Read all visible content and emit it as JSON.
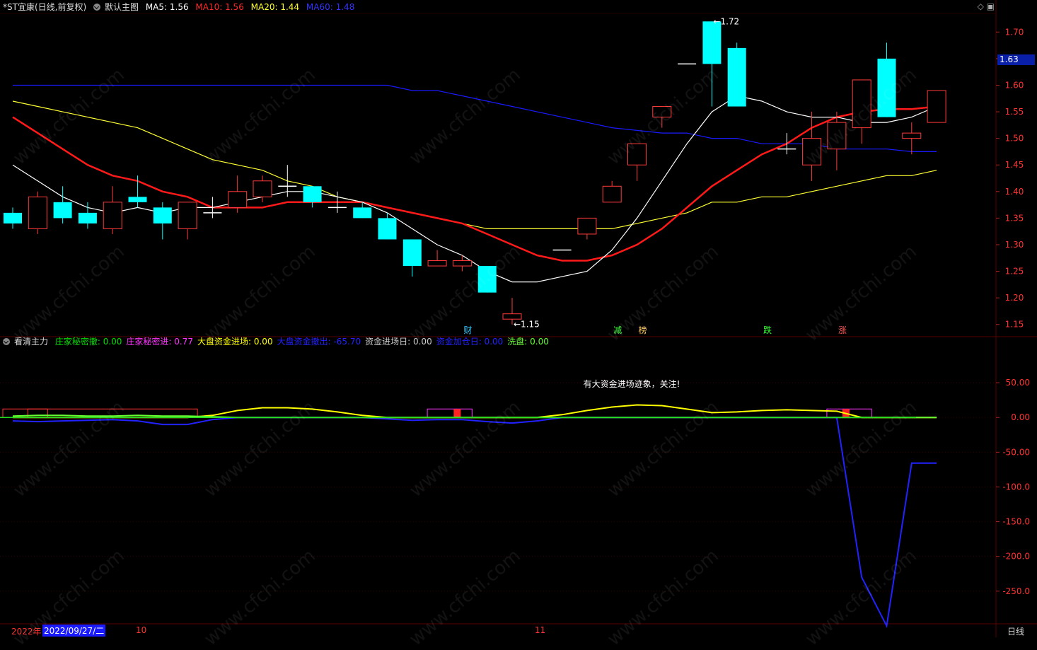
{
  "header": {
    "stock": "*ST宜康",
    "period": "(日线,前复权)",
    "main_chart_label": "默认主图",
    "ma5": "MA5: 1.56",
    "ma10": "MA10: 1.56",
    "ma20": "MA20: 1.44",
    "ma60": "MA60: 1.48"
  },
  "indicator_header": {
    "name": "看清主力",
    "items": [
      {
        "label": "庄家秘密撤: 0.00",
        "color": "#00e000"
      },
      {
        "label": "庄家秘密进: 0.77",
        "color": "#ff33ff"
      },
      {
        "label": "大盘资金进场: 0.00",
        "color": "#ffff00"
      },
      {
        "label": "大盘资金撤出: -65.70",
        "color": "#2222ff"
      },
      {
        "label": "资金进场日: 0.00",
        "color": "#cccccc"
      },
      {
        "label": "资金加仓日: 0.00",
        "color": "#2222ff"
      },
      {
        "label": "洗盘: 0.00",
        "color": "#66ff33"
      }
    ]
  },
  "top_icons": "◇ ▣",
  "current_price": "1.63",
  "footer": {
    "year": "2022年",
    "date": "2022/09/27/二",
    "month_oct": "10",
    "month_nov": "11",
    "period_label": "日线"
  },
  "watermark": "www.cfchi.com",
  "colors": {
    "up": "#ff3b3b",
    "down": "#00ffff",
    "ma5": "#ffffff",
    "ma10": "#ff1a1a",
    "ma20": "#ffff33",
    "ma60": "#1a1aff",
    "grid": "#5a0000"
  },
  "chart_data": [
    {
      "type": "candlestick",
      "price_axis": {
        "ticks": [
          "1.70",
          "1.65",
          "1.60",
          "1.55",
          "1.50",
          "1.45",
          "1.40",
          "1.35",
          "1.30",
          "1.25",
          "1.20",
          "1.15"
        ],
        "ylim": [
          1.135,
          1.735
        ]
      },
      "candles": [
        {
          "o": 1.36,
          "h": 1.37,
          "l": 1.33,
          "c": 1.34
        },
        {
          "o": 1.33,
          "h": 1.4,
          "l": 1.32,
          "c": 1.39
        },
        {
          "o": 1.38,
          "h": 1.41,
          "l": 1.34,
          "c": 1.35
        },
        {
          "o": 1.36,
          "h": 1.38,
          "l": 1.33,
          "c": 1.34
        },
        {
          "o": 1.33,
          "h": 1.41,
          "l": 1.32,
          "c": 1.38
        },
        {
          "o": 1.39,
          "h": 1.43,
          "l": 1.37,
          "c": 1.38
        },
        {
          "o": 1.37,
          "h": 1.38,
          "l": 1.31,
          "c": 1.34
        },
        {
          "o": 1.33,
          "h": 1.38,
          "l": 1.31,
          "c": 1.38
        },
        {
          "o": 1.36,
          "h": 1.39,
          "l": 1.35,
          "c": 1.36
        },
        {
          "o": 1.37,
          "h": 1.43,
          "l": 1.36,
          "c": 1.4
        },
        {
          "o": 1.39,
          "h": 1.43,
          "l": 1.38,
          "c": 1.42
        },
        {
          "o": 1.41,
          "h": 1.45,
          "l": 1.39,
          "c": 1.41
        },
        {
          "o": 1.41,
          "h": 1.41,
          "l": 1.37,
          "c": 1.38
        },
        {
          "o": 1.37,
          "h": 1.4,
          "l": 1.36,
          "c": 1.37
        },
        {
          "o": 1.37,
          "h": 1.38,
          "l": 1.35,
          "c": 1.35
        },
        {
          "o": 1.35,
          "h": 1.36,
          "l": 1.31,
          "c": 1.31
        },
        {
          "o": 1.31,
          "h": 1.31,
          "l": 1.24,
          "c": 1.26
        },
        {
          "o": 1.26,
          "h": 1.29,
          "l": 1.26,
          "c": 1.27
        },
        {
          "o": 1.26,
          "h": 1.28,
          "l": 1.25,
          "c": 1.27
        },
        {
          "o": 1.26,
          "h": 1.26,
          "l": 1.21,
          "c": 1.21
        },
        {
          "o": 1.16,
          "h": 1.2,
          "l": 1.15,
          "c": 1.17
        },
        null,
        {
          "o": 1.29,
          "h": 1.29,
          "l": 1.29,
          "c": 1.29
        },
        {
          "o": 1.32,
          "h": 1.35,
          "l": 1.31,
          "c": 1.35
        },
        {
          "o": 1.38,
          "h": 1.42,
          "l": 1.38,
          "c": 1.41
        },
        {
          "o": 1.45,
          "h": 1.49,
          "l": 1.42,
          "c": 1.49
        },
        {
          "o": 1.54,
          "h": 1.56,
          "l": 1.52,
          "c": 1.56
        },
        {
          "o": 1.64,
          "h": 1.64,
          "l": 1.64,
          "c": 1.64
        },
        {
          "o": 1.72,
          "h": 1.72,
          "l": 1.56,
          "c": 1.64
        },
        {
          "o": 1.67,
          "h": 1.68,
          "l": 1.56,
          "c": 1.56
        },
        null,
        {
          "o": 1.48,
          "h": 1.51,
          "l": 1.47,
          "c": 1.48
        },
        {
          "o": 1.45,
          "h": 1.55,
          "l": 1.42,
          "c": 1.5
        },
        {
          "o": 1.48,
          "h": 1.55,
          "l": 1.44,
          "c": 1.53
        },
        {
          "o": 1.52,
          "h": 1.61,
          "l": 1.49,
          "c": 1.61
        },
        {
          "o": 1.65,
          "h": 1.68,
          "l": 1.54,
          "c": 1.54
        },
        {
          "o": 1.5,
          "h": 1.53,
          "l": 1.47,
          "c": 1.51
        },
        {
          "o": 1.53,
          "h": 1.59,
          "l": 1.53,
          "c": 1.59
        }
      ],
      "ma5": [
        1.45,
        1.42,
        1.39,
        1.37,
        1.36,
        1.37,
        1.36,
        1.37,
        1.37,
        1.38,
        1.39,
        1.4,
        1.4,
        1.39,
        1.38,
        1.36,
        1.33,
        1.3,
        1.28,
        1.25,
        1.23,
        1.23,
        1.24,
        1.25,
        1.29,
        1.35,
        1.42,
        1.49,
        1.55,
        1.58,
        1.57,
        1.55,
        1.54,
        1.54,
        1.53,
        1.53,
        1.54,
        1.56
      ],
      "ma10": [
        1.54,
        1.51,
        1.48,
        1.45,
        1.43,
        1.42,
        1.4,
        1.39,
        1.37,
        1.37,
        1.37,
        1.38,
        1.38,
        1.38,
        1.38,
        1.37,
        1.36,
        1.35,
        1.34,
        1.32,
        1.3,
        1.28,
        1.27,
        1.27,
        1.28,
        1.3,
        1.33,
        1.37,
        1.41,
        1.44,
        1.47,
        1.49,
        1.52,
        1.54,
        1.55,
        1.555,
        1.555,
        1.56
      ],
      "ma20": [
        1.57,
        1.56,
        1.55,
        1.54,
        1.53,
        1.52,
        1.5,
        1.48,
        1.46,
        1.45,
        1.44,
        1.42,
        1.41,
        1.39,
        1.38,
        1.37,
        1.36,
        1.35,
        1.34,
        1.33,
        1.33,
        1.33,
        1.33,
        1.33,
        1.33,
        1.34,
        1.35,
        1.36,
        1.38,
        1.38,
        1.39,
        1.39,
        1.4,
        1.41,
        1.42,
        1.43,
        1.43,
        1.44
      ],
      "ma60": [
        1.6,
        1.6,
        1.6,
        1.6,
        1.6,
        1.6,
        1.6,
        1.6,
        1.6,
        1.6,
        1.6,
        1.6,
        1.6,
        1.6,
        1.6,
        1.6,
        1.59,
        1.59,
        1.58,
        1.57,
        1.56,
        1.55,
        1.54,
        1.53,
        1.52,
        1.515,
        1.51,
        1.51,
        1.5,
        1.5,
        1.49,
        1.49,
        1.49,
        1.48,
        1.48,
        1.48,
        1.475,
        1.475
      ],
      "annotations": [
        {
          "index": 28,
          "text": "1.72",
          "price": 1.72,
          "arrow": "←"
        },
        {
          "index": 20,
          "text": "1.15",
          "price": 1.15,
          "arrow": "←"
        }
      ],
      "event_labels": [
        {
          "index": 18,
          "text": "财",
          "color": "#33ccff"
        },
        {
          "index": 24,
          "text": "减",
          "color": "#33ff33"
        },
        {
          "index": 25,
          "text": "榜",
          "color": "#ffcc66"
        },
        {
          "index": 30,
          "text": "跌",
          "color": "#33ff33"
        },
        {
          "index": 33,
          "text": "涨",
          "color": "#ff5555"
        }
      ]
    },
    {
      "type": "line",
      "title": "看清主力",
      "y_axis": {
        "ticks": [
          "50.00",
          "0.00",
          "-50.00",
          "-100.0",
          "-150.0",
          "-200.0",
          "-250.0"
        ],
        "ylim": [
          -295,
          100
        ]
      },
      "note": "有大资金进场迹象，关注!",
      "series": [
        {
          "name": "大盘资金进场",
          "color": "#ffff00",
          "values": [
            0,
            0,
            0,
            0,
            0,
            0,
            0,
            0,
            3,
            10,
            14,
            14,
            12,
            8,
            3,
            0,
            0,
            0,
            0,
            0,
            0,
            0,
            4,
            10,
            15,
            18,
            17,
            12,
            7,
            8,
            10,
            11,
            10,
            9,
            0,
            0,
            0,
            0
          ]
        },
        {
          "name": "大盘资金撤出",
          "color": "#2222ff",
          "values": [
            -5,
            -6,
            -5,
            -4,
            -3,
            -5,
            -10,
            -10,
            -3,
            0,
            0,
            0,
            0,
            0,
            0,
            -2,
            -4,
            -3,
            -3,
            -6,
            -8,
            -5,
            0,
            0,
            0,
            0,
            0,
            0,
            0,
            0,
            0,
            0,
            0,
            0,
            -230,
            -300,
            -65.7,
            -65.7
          ]
        },
        {
          "name": "洗盘",
          "color": "#66ff33",
          "values": [
            2,
            3,
            3,
            2,
            2,
            3,
            2,
            2,
            1,
            0,
            0,
            0,
            0,
            0,
            0,
            0,
            0,
            0,
            0,
            0,
            0,
            0,
            0,
            0,
            0,
            0,
            0,
            0,
            0,
            0,
            0,
            0,
            0,
            0,
            0,
            0,
            0,
            0
          ]
        }
      ]
    }
  ]
}
